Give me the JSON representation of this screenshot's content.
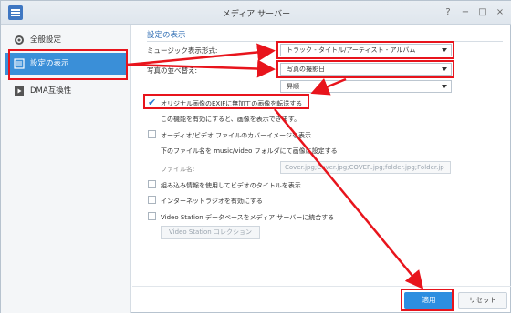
{
  "window": {
    "title": "メディア サーバー",
    "controls": [
      "?",
      "−",
      "□",
      "×"
    ]
  },
  "sidebar": {
    "items": [
      {
        "label": "全般設定",
        "icon": "gear-icon"
      },
      {
        "label": "設定の表示",
        "icon": "list-icon"
      },
      {
        "label": "DMA互換性",
        "icon": "play-icon"
      }
    ],
    "active_index": 1
  },
  "main": {
    "section_title": "設定の表示",
    "music_label": "ミュージック表示形式:",
    "music_value": "トラック - タイトル/アーティスト - アルバム",
    "photo_label": "写真の並べ替え:",
    "photo_value": "写真の撮影日",
    "order_value": "昇順",
    "options": [
      {
        "label": "オリジナル画像のEXIFに無加工の画像を転送する",
        "checked": true
      },
      {
        "label": "この機能を有効にすると、画像を表示できます。",
        "type": "note"
      },
      {
        "label": "オーディオ/ビデオ ファイルのカバーイメージを表示",
        "checked": false
      },
      {
        "label": "下のファイル名を music/video フォルダにて画像に設定する",
        "type": "note"
      },
      {
        "label": "ファイル名:",
        "type": "field",
        "value": "Cover.jpg;Cover.jpg;COVER.jpg;folder.jpg;Folder.jp"
      },
      {
        "label": "組み込み情報を使用してビデオのタイトルを表示",
        "checked": false
      },
      {
        "label": "インターネットラジオを有効にする",
        "checked": false
      },
      {
        "label": "Video Station データベースをメディア サーバーに統合する",
        "checked": false
      }
    ],
    "video_button": "Video Station コレクション",
    "apply_label": "適用",
    "reset_label": "リセット"
  },
  "colors": {
    "accent": "#3a8fd8",
    "highlight": "#e8141c",
    "apply": "#2d8ee0"
  }
}
